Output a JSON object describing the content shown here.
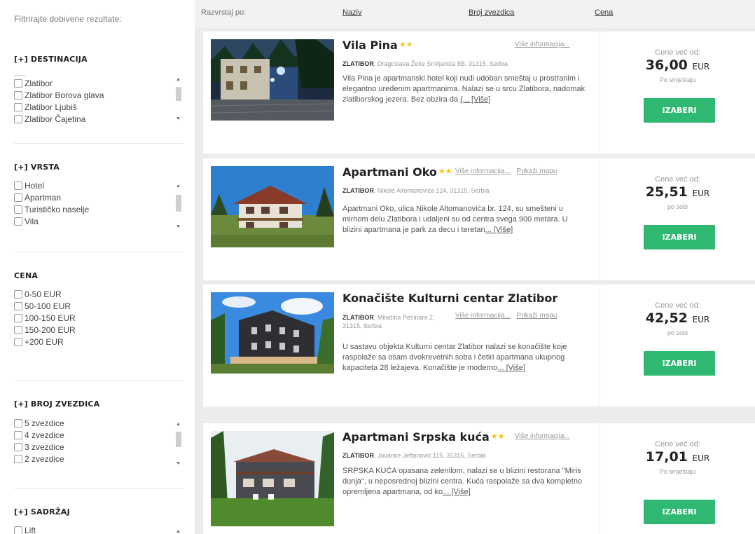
{
  "sidebar": {
    "title": "Filtrirajte dobivene rezultate:",
    "sections": {
      "destinacija": {
        "heading": "[+] DESTINACIJA",
        "items": [
          "Zlatibor",
          "Zlatibor Borova glava",
          "Zlatibor Ljubiš",
          "Zlatibor Čajetina"
        ]
      },
      "vrsta": {
        "heading": "[+] VRSTA",
        "items": [
          "Hotel",
          "Apartman",
          "Turističko naselje",
          "Vila"
        ]
      },
      "cena": {
        "heading": "CENA",
        "items": [
          "0-50 EUR",
          "50-100 EUR",
          "100-150 EUR",
          "150-200 EUR",
          "+200 EUR"
        ]
      },
      "zvezdice": {
        "heading": "[+] BROJ ZVEZDICA",
        "items": [
          "5 zvezdice",
          "4 zvezdice",
          "3 zvezdice",
          "2 zvezdice"
        ]
      },
      "sadrzaj": {
        "heading": "[+] SADRŽAJ",
        "items": [
          "Lift"
        ]
      }
    },
    "scroll_up": "▲",
    "scroll_down": "▼"
  },
  "sortbar": {
    "label": "Razvrstaj po:",
    "options": [
      "Naziv",
      "Broj zvezdica",
      "Cena"
    ]
  },
  "results": [
    {
      "name": "Vila Pina",
      "stars": "★★",
      "info_link": "Više informacija...",
      "map_link": "",
      "city": "ZLATIBOR",
      "address": ", Dragoslava Žeke Smiljanića 8B, 31315, Serbia",
      "description": "Vila Pina je apartmanski hotel koji nudi udoban smeštaj u prostranim i elegantno uređenim apartmanima. Nalazi se u srcu Zlatibora, nadomak zlatiborskog jezera. Bez obzira da",
      "more": "(... [Više]",
      "price_from": "Cene već od:",
      "price": "36,00",
      "currency": "EUR",
      "unit": "Po smještaju",
      "button": "IZABERI"
    },
    {
      "name": "Apartmani Oko",
      "stars": "★★",
      "info_link": "Više informacija...",
      "map_link": "Prikaži mapu",
      "city": "ZLATIBOR",
      "address": ", Nikole Altomanovića 124, 31315, Serbia",
      "description": "Apartmani Oko, ulica Nikole Altomanovića br. 124, su smešteni u mirnom delu Zlatibora i udaljeni su od centra svega 900 metara. U blizini apartmana je park za decu i teretan",
      "more": "... [Više]",
      "price_from": "Cene već od:",
      "price": "25,51",
      "currency": "EUR",
      "unit": "po sobi",
      "button": "IZABERI"
    },
    {
      "name": "Konačište Kulturni centar Zlatibor",
      "stars": "",
      "info_link": "Više informacija...",
      "map_link": "Prikaži mapu",
      "city": "ZLATIBOR",
      "address": ", Miladina Pećinara 2, 31315, Serbia",
      "description": "U sastavu objekta Kulturni centar Zlatibor nalazi se konačište koje raspolaže sa osam dvokrevetnih soba i četiri apartmana ukupnog kapaciteta 28 ležajeva. Konačište je moderno",
      "more": "... [Više]",
      "price_from": "Cene već od:",
      "price": "42,52",
      "currency": "EUR",
      "unit": "po sobi",
      "button": "IZABERI"
    },
    {
      "name": "Apartmani Srpska kuća",
      "stars": "★★",
      "info_link": "Više informacija...",
      "map_link": "",
      "city": "ZLATIBOR",
      "address": ", Jovanke Jeftanović 115, 31315, Serbia",
      "description": "SRPSKA KUĆA opasana zelenilom, nalazi se u blizini restorana \"Miris dunja\", u neposrednoj blizini centra. Kuća raspolaže sa dva kompletno opremljena apartmana, od ko",
      "more": "... [Više]",
      "price_from": "Cene već od:",
      "price": "17,01",
      "currency": "EUR",
      "unit": "Po smještaju",
      "button": "IZABERI"
    }
  ],
  "colors": {
    "button": "#2eb872",
    "stars": "#f5c518",
    "background": "#ececec"
  }
}
